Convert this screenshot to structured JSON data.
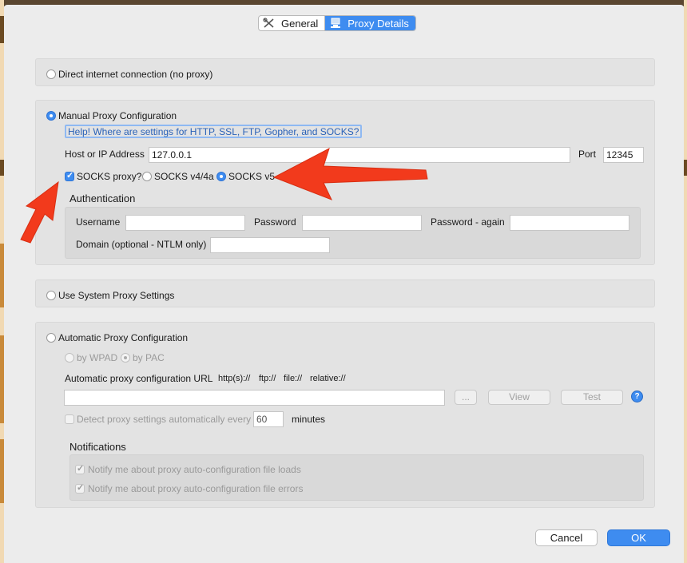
{
  "tabs": [
    {
      "label": "General",
      "icon": "tools-icon",
      "active": false
    },
    {
      "label": "Proxy Details",
      "icon": "network-icon",
      "active": true
    }
  ],
  "direct": {
    "label": "Direct internet connection (no proxy)",
    "selected": false
  },
  "manual": {
    "label": "Manual Proxy Configuration",
    "selected": true,
    "help_link": "Help! Where are settings for HTTP, SSL, FTP, Gopher, and SOCKS?",
    "host_label": "Host or IP Address",
    "host_value": "127.0.0.1",
    "port_label": "Port",
    "port_value": "12345",
    "socks_label": "SOCKS proxy?",
    "socks_checked": true,
    "socks_v4_label": "SOCKS v4/4a",
    "socks_v5_label": "SOCKS v5",
    "socks_version": "v5",
    "auth": {
      "heading": "Authentication",
      "username_label": "Username",
      "username_value": "",
      "password_label": "Password",
      "password_value": "",
      "password_again_label": "Password - again",
      "password_again_value": "",
      "domain_label": "Domain (optional - NTLM only)",
      "domain_value": ""
    }
  },
  "system": {
    "label": "Use System Proxy Settings",
    "selected": false
  },
  "auto": {
    "label": "Automatic Proxy Configuration",
    "selected": false,
    "by_wpad": "by WPAD",
    "by_pac": "by PAC",
    "url_label": "Automatic proxy configuration URL",
    "schemes": [
      "http(s)://",
      "ftp://",
      "file://",
      "relative://"
    ],
    "url_value": "",
    "browse_label": "...",
    "view_label": "View",
    "test_label": "Test",
    "detect_label": "Detect proxy settings automatically every",
    "detect_checked": false,
    "detect_value": "60",
    "minutes_label": "minutes",
    "notifications_heading": "Notifications",
    "notify_loads": "Notify me about proxy auto-configuration file loads",
    "notify_errors": "Notify me about proxy auto-configuration file errors",
    "notify_loads_checked": true,
    "notify_errors_checked": true
  },
  "buttons": {
    "cancel": "Cancel",
    "ok": "OK"
  },
  "colors": {
    "accent": "#3e8cf0",
    "annotation_arrow": "#f23a1c"
  }
}
